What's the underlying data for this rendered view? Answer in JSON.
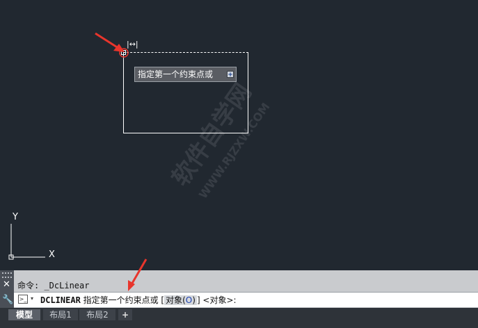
{
  "tooltip": {
    "text": "指定第一个约束点或",
    "expand": "+"
  },
  "canvas": {
    "dim_icon": "|↔|"
  },
  "watermark": {
    "line1": "软件自学网",
    "line2": "WWW.RJZXW.COM"
  },
  "ucs": {
    "x_label": "X",
    "y_label": "Y"
  },
  "command": {
    "history": "命令: _DcLinear",
    "close": "✕",
    "wrench": "🔧",
    "prompt_icon": ">_",
    "dropdown": "▾",
    "cmd_name": "DCLINEAR",
    "prompt": " 指定第一个约束点或 [",
    "option_label": "对象(",
    "option_key": "O",
    "option_close": ")",
    "prompt_tail": "] <对象>:"
  },
  "tabs": {
    "model": "模型",
    "layout1": "布局1",
    "layout2": "布局2",
    "add": "+"
  },
  "colors": {
    "canvas": "#212830",
    "arrow": "#e8352c",
    "accent": "#1b3fb0"
  }
}
